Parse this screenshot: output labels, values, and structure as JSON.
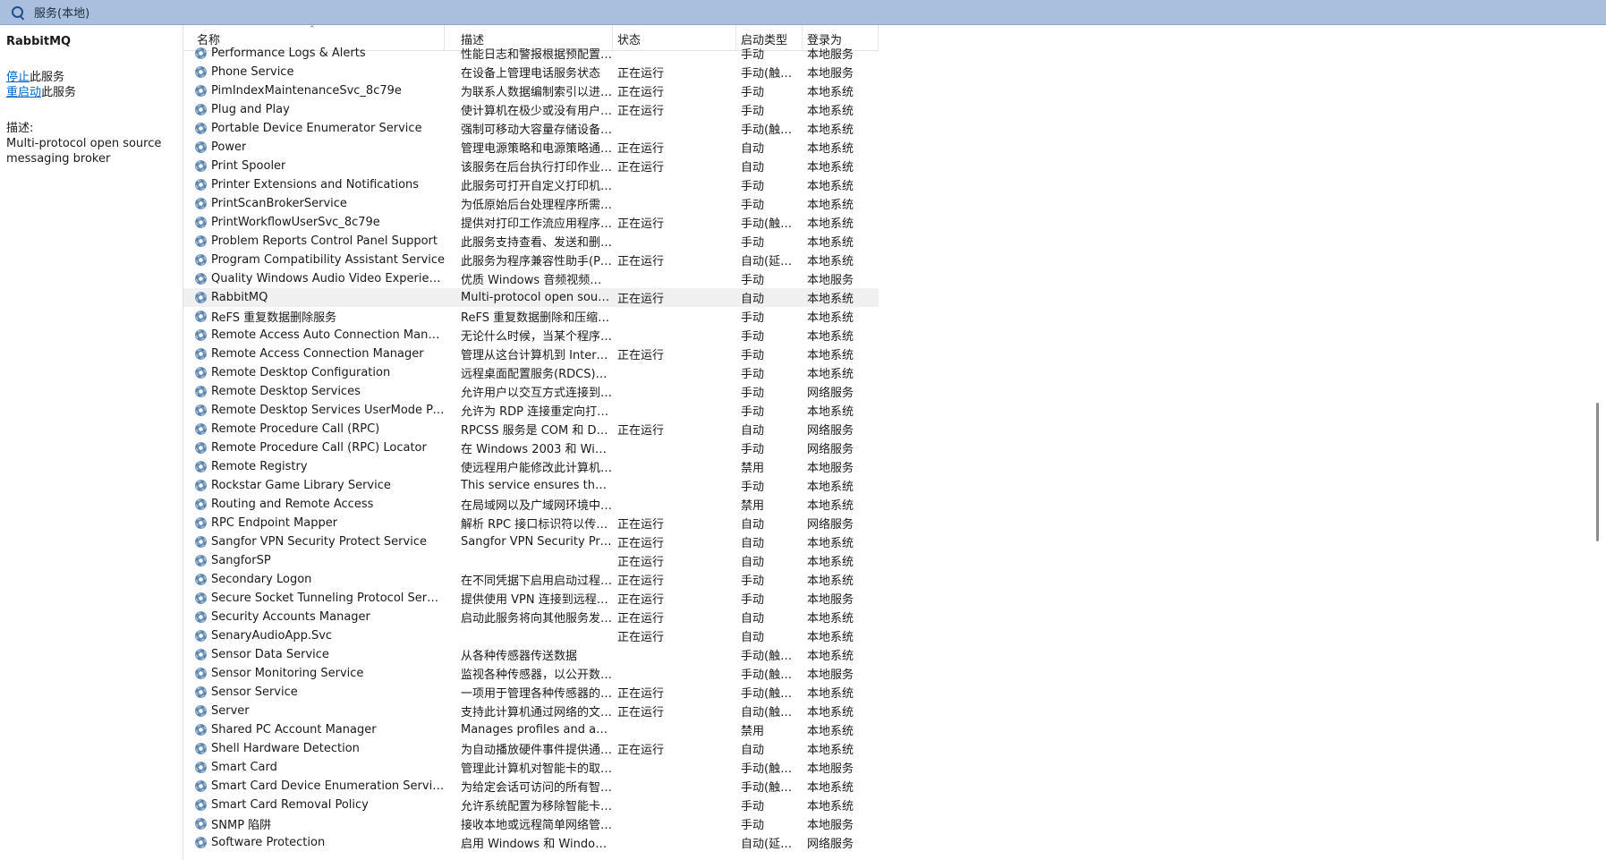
{
  "window": {
    "title": "服务(本地)"
  },
  "left": {
    "service_name": "RabbitMQ",
    "stop_link": "停止",
    "stop_suffix": "此服务",
    "restart_link": "重启动",
    "restart_suffix": "此服务",
    "desc_label": "描述:",
    "desc_text": "Multi-protocol open source messaging broker"
  },
  "columns": {
    "name": "名称",
    "desc": "描述",
    "status": "状态",
    "startup": "启动类型",
    "logon": "登录为"
  },
  "selected_row": 13,
  "rows": [
    {
      "name": "Performance Logs & Alerts",
      "desc": "性能日志和警报根据预配置的计...",
      "status": "",
      "startup": "手动",
      "logon": "本地服务"
    },
    {
      "name": "Phone Service",
      "desc": "在设备上管理电话服务状态",
      "status": "正在运行",
      "startup": "手动(触发...",
      "logon": "本地服务"
    },
    {
      "name": "PimIndexMaintenanceSvc_8c79e",
      "desc": "为联系人数据编制索引以进行快...",
      "status": "正在运行",
      "startup": "手动",
      "logon": "本地系统"
    },
    {
      "name": "Plug and Play",
      "desc": "使计算机在极少或没有用户输入...",
      "status": "正在运行",
      "startup": "手动",
      "logon": "本地系统"
    },
    {
      "name": "Portable Device Enumerator Service",
      "desc": "强制可移动大容量存储设备的组...",
      "status": "",
      "startup": "手动(触发...",
      "logon": "本地系统"
    },
    {
      "name": "Power",
      "desc": "管理电源策略和电源策略通知传...",
      "status": "正在运行",
      "startup": "自动",
      "logon": "本地系统"
    },
    {
      "name": "Print Spooler",
      "desc": "该服务在后台执行打印作业并处...",
      "status": "正在运行",
      "startup": "自动",
      "logon": "本地系统"
    },
    {
      "name": "Printer Extensions and Notifications",
      "desc": "此服务可打开自定义打印机对话...",
      "status": "",
      "startup": "手动",
      "logon": "本地系统"
    },
    {
      "name": "PrintScanBrokerService",
      "desc": "为低原始后台处理程序所需的安...",
      "status": "",
      "startup": "手动",
      "logon": "本地系统"
    },
    {
      "name": "PrintWorkflowUserSvc_8c79e",
      "desc": "提供对打印工作流应用程序的支...",
      "status": "正在运行",
      "startup": "手动(触发...",
      "logon": "本地系统"
    },
    {
      "name": "Problem Reports Control Panel Support",
      "desc": "此服务支持查看、发送和删除\"...",
      "status": "",
      "startup": "手动",
      "logon": "本地系统"
    },
    {
      "name": "Program Compatibility Assistant Service",
      "desc": "此服务为程序兼容性助手(PCA)...",
      "status": "正在运行",
      "startup": "自动(延迟...",
      "logon": "本地系统"
    },
    {
      "name": "Quality Windows Audio Video Experience",
      "desc": "优质 Windows 音频视频体验(...",
      "status": "",
      "startup": "手动",
      "logon": "本地服务"
    },
    {
      "name": "RabbitMQ",
      "desc": "Multi-protocol open source ...",
      "status": "正在运行",
      "startup": "自动",
      "logon": "本地系统"
    },
    {
      "name": "ReFS 重复数据删除服务",
      "desc": "ReFS 重复数据删除和压缩服务...",
      "status": "",
      "startup": "手动",
      "logon": "本地系统"
    },
    {
      "name": "Remote Access Auto Connection Manager",
      "desc": "无论什么时候，当某个程序引用...",
      "status": "",
      "startup": "手动",
      "logon": "本地系统"
    },
    {
      "name": "Remote Access Connection Manager",
      "desc": "管理从这台计算机到 Internet ...",
      "status": "正在运行",
      "startup": "手动",
      "logon": "本地系统"
    },
    {
      "name": "Remote Desktop Configuration",
      "desc": "远程桌面配置服务(RDCS)负责...",
      "status": "",
      "startup": "手动",
      "logon": "本地系统"
    },
    {
      "name": "Remote Desktop Services",
      "desc": "允许用户以交互方式连接到远程...",
      "status": "",
      "startup": "手动",
      "logon": "网络服务"
    },
    {
      "name": "Remote Desktop Services UserMode Port R...",
      "desc": "允许为 RDP 连接重定向打印机...",
      "status": "",
      "startup": "手动",
      "logon": "本地系统"
    },
    {
      "name": "Remote Procedure Call (RPC)",
      "desc": "RPCSS 服务是 COM 和 DCO...",
      "status": "正在运行",
      "startup": "自动",
      "logon": "网络服务"
    },
    {
      "name": "Remote Procedure Call (RPC) Locator",
      "desc": "在 Windows 2003 和 Window...",
      "status": "",
      "startup": "手动",
      "logon": "网络服务"
    },
    {
      "name": "Remote Registry",
      "desc": "使远程用户能修改此计算机上的...",
      "status": "",
      "startup": "禁用",
      "logon": "本地服务"
    },
    {
      "name": "Rockstar Game Library Service",
      "desc": "This service ensures the inte...",
      "status": "",
      "startup": "手动",
      "logon": "本地系统"
    },
    {
      "name": "Routing and Remote Access",
      "desc": "在局域网以及广域网环境中为企...",
      "status": "",
      "startup": "禁用",
      "logon": "本地系统"
    },
    {
      "name": "RPC Endpoint Mapper",
      "desc": "解析 RPC 接口标识符以传输端...",
      "status": "正在运行",
      "startup": "自动",
      "logon": "网络服务"
    },
    {
      "name": "Sangfor VPN Security Protect Service",
      "desc": "Sangfor VPN Security Protec...",
      "status": "正在运行",
      "startup": "自动",
      "logon": "本地系统"
    },
    {
      "name": "SangforSP",
      "desc": "",
      "status": "正在运行",
      "startup": "自动",
      "logon": "本地系统"
    },
    {
      "name": "Secondary Logon",
      "desc": "在不同凭据下启用启动过程。如...",
      "status": "正在运行",
      "startup": "手动",
      "logon": "本地系统"
    },
    {
      "name": "Secure Socket Tunneling Protocol Service",
      "desc": "提供使用 VPN 连接到远程计算...",
      "status": "正在运行",
      "startup": "手动",
      "logon": "本地服务"
    },
    {
      "name": "Security Accounts Manager",
      "desc": "启动此服务将向其他服务发出信...",
      "status": "正在运行",
      "startup": "自动",
      "logon": "本地系统"
    },
    {
      "name": "SenaryAudioApp.Svc",
      "desc": "",
      "status": "正在运行",
      "startup": "自动",
      "logon": "本地系统"
    },
    {
      "name": "Sensor Data Service",
      "desc": "从各种传感器传送数据",
      "status": "",
      "startup": "手动(触发...",
      "logon": "本地系统"
    },
    {
      "name": "Sensor Monitoring Service",
      "desc": "监视各种传感器，以公开数据和...",
      "status": "",
      "startup": "手动(触发...",
      "logon": "本地服务"
    },
    {
      "name": "Sensor Service",
      "desc": "一项用于管理各种传感器的功能...",
      "status": "正在运行",
      "startup": "手动(触发...",
      "logon": "本地系统"
    },
    {
      "name": "Server",
      "desc": "支持此计算机通过网络的文件、...",
      "status": "正在运行",
      "startup": "自动(触发...",
      "logon": "本地系统"
    },
    {
      "name": "Shared PC Account Manager",
      "desc": "Manages profiles and accou...",
      "status": "",
      "startup": "禁用",
      "logon": "本地系统"
    },
    {
      "name": "Shell Hardware Detection",
      "desc": "为自动播放硬件事件提供通知。",
      "status": "正在运行",
      "startup": "自动",
      "logon": "本地系统"
    },
    {
      "name": "Smart Card",
      "desc": "管理此计算机对智能卡的取读访...",
      "status": "",
      "startup": "手动(触发...",
      "logon": "本地服务"
    },
    {
      "name": "Smart Card Device Enumeration Service",
      "desc": "为给定会话可访问的所有智能卡...",
      "status": "",
      "startup": "手动(触发...",
      "logon": "本地系统"
    },
    {
      "name": "Smart Card Removal Policy",
      "desc": "允许系统配置为移除智能卡时锁...",
      "status": "",
      "startup": "手动",
      "logon": "本地系统"
    },
    {
      "name": "SNMP 陷阱",
      "desc": "接收本地或远程简单网络管理协...",
      "status": "",
      "startup": "手动",
      "logon": "本地服务"
    },
    {
      "name": "Software Protection",
      "desc": "启用 Windows 和 Windows ...",
      "status": "",
      "startup": "自动(延迟...",
      "logon": "网络服务"
    }
  ]
}
